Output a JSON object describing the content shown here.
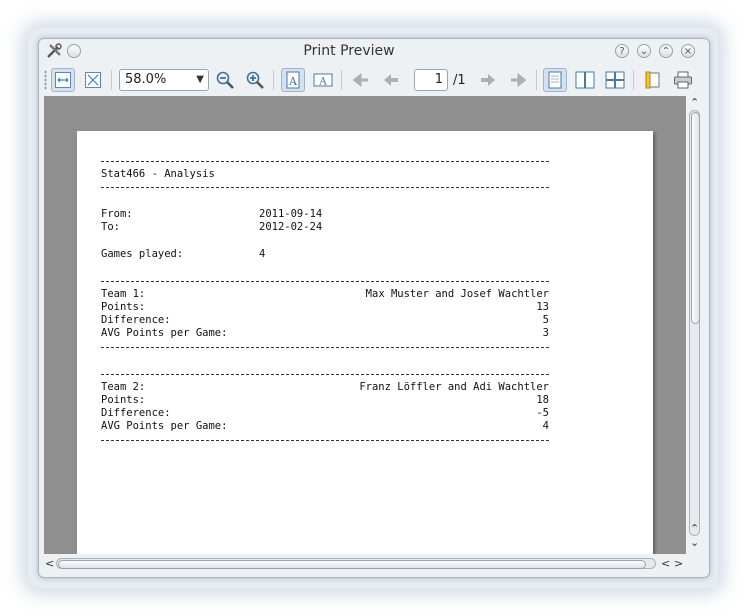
{
  "window": {
    "title": "Print Preview"
  },
  "toolbar": {
    "zoom_value": "58.0%",
    "page_current": "1",
    "page_total": "/1"
  },
  "icons": {
    "app": "tools-icon",
    "fit_width": "fit-width-icon",
    "fit_page": "fit-page-icon",
    "zoom_out": "zoom-out-icon",
    "zoom_in": "zoom-in-icon",
    "portrait": "portrait-icon",
    "landscape": "landscape-icon",
    "first": "first-page-icon",
    "prev": "previous-page-icon",
    "next": "next-page-icon",
    "last": "last-page-icon",
    "single": "single-page-icon",
    "facing": "facing-pages-icon",
    "overview": "overview-icon",
    "setup": "page-setup-icon",
    "print": "print-icon"
  },
  "report": {
    "title": "Stat466 - Analysis",
    "from_label": "From:",
    "from_value": "2011-09-14",
    "to_label": "To:",
    "to_value": "2012-02-24",
    "games_label": "Games played:",
    "games_value": "4",
    "team1": {
      "label": "Team 1:",
      "names": "Max Muster and Josef Wachtler",
      "points_label": "Points:",
      "points": "13",
      "difference_label": "Difference:",
      "difference": "5",
      "avg_label": "AVG Points per Game:",
      "avg": "3"
    },
    "team2": {
      "label": "Team 2:",
      "names": "Franz Löffler and Adi Wachtler",
      "points_label": "Points:",
      "points": "18",
      "difference_label": "Difference:",
      "difference": "-5",
      "avg_label": "AVG Points per Game:",
      "avg": "4"
    }
  },
  "colors": {
    "page_background": "#8f8f8f",
    "window_background": "#eef1f4",
    "accent": "#3f7fc0"
  }
}
